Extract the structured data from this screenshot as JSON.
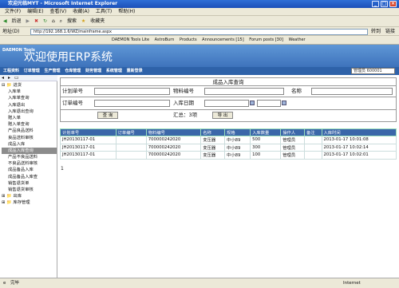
{
  "window": {
    "title": "欢迎光临MYT - Microsoft Internet Explorer"
  },
  "menu": [
    "文件(F)",
    "编辑(E)",
    "查看(V)",
    "收藏(A)",
    "工具(T)",
    "帮助(H)"
  ],
  "toolbar": {
    "back": "后退",
    "search": "搜索",
    "favorites": "收藏夹"
  },
  "address": {
    "label": "地址(D)",
    "url": "http://192.168.1.6/WZ/mainframe.aspx",
    "go": "转到",
    "links": "链接"
  },
  "linksbar": [
    "DAEMON Tools Lite",
    "AstroBurn",
    "Products",
    "Announcements [15]",
    "Forum posts [30]",
    "Weather"
  ],
  "banner": {
    "logo": "DAEMON Tools",
    "title": "欢迎使用ERP系统"
  },
  "nav": [
    "工程资料",
    "订单管理",
    "生产管理",
    "仓库管理",
    "财务管理",
    "系统管理",
    "重新登录"
  ],
  "user": "管理员 600001",
  "tree": [
    {
      "label": "⊟ 📁 进货",
      "indent": 0
    },
    {
      "label": "入库单",
      "indent": 1
    },
    {
      "label": "入库单查询",
      "indent": 1
    },
    {
      "label": "入库退出",
      "indent": 1
    },
    {
      "label": "入库退出查询",
      "indent": 1
    },
    {
      "label": "赠入单",
      "indent": 1
    },
    {
      "label": "赠入单查询",
      "indent": 1
    },
    {
      "label": "产品良品送料",
      "indent": 1
    },
    {
      "label": "良品送料审核",
      "indent": 1
    },
    {
      "label": "成品入库",
      "indent": 1
    },
    {
      "label": "成品入库查询",
      "indent": 1,
      "selected": true
    },
    {
      "label": "产品不良品送料",
      "indent": 1
    },
    {
      "label": "不良品送料审核",
      "indent": 1
    },
    {
      "label": "成品备品入库",
      "indent": 1
    },
    {
      "label": "成品备品入库查",
      "indent": 1
    },
    {
      "label": "销售退货单",
      "indent": 1
    },
    {
      "label": "销售退货审核",
      "indent": 1
    },
    {
      "label": "⊞ 📁 出库",
      "indent": 0
    },
    {
      "label": "⊞ 📁 库存管理",
      "indent": 0
    }
  ],
  "form": {
    "title": "成品入库查询",
    "plan_no": "计划单号",
    "material_no": "物料编号",
    "name": "名称",
    "order_no": "订单编号",
    "in_date": "入库日期",
    "query_btn": "查 询",
    "summary": "汇总：3项",
    "export_btn": "导 出"
  },
  "table": {
    "headers": [
      "计划单号",
      "订单编号",
      "物料编号",
      "名称",
      "规格",
      "入库数量",
      "操作人",
      "备注",
      "入库时间"
    ],
    "rows": [
      [
        "JH20130117-01",
        "",
        "700000242020",
        "变压器",
        "中小89",
        "500",
        "管理员",
        "",
        "2013-01-17 10:01:08"
      ],
      [
        "JH20130117-01",
        "",
        "700000242020",
        "变压器",
        "中小89",
        "300",
        "管理员",
        "",
        "2013-01-17 10:02:14"
      ],
      [
        "JH20130117-01",
        "",
        "700000242020",
        "变压器",
        "中小89",
        "100",
        "管理员",
        "",
        "2013-01-17 10:02:01"
      ]
    ]
  },
  "pager": "1",
  "status": {
    "left": "完毕",
    "right": "Internet"
  }
}
